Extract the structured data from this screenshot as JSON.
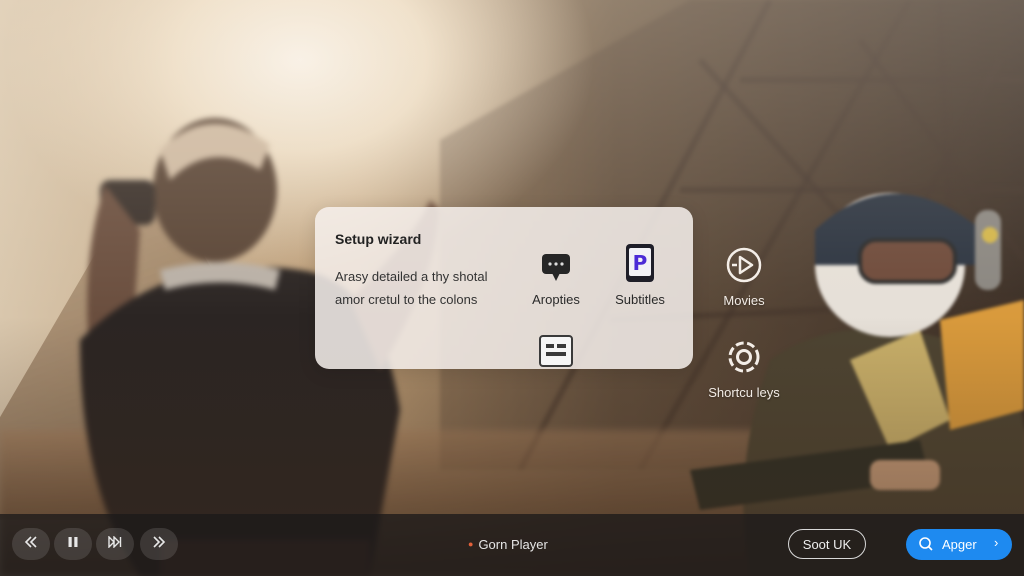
{
  "wizard": {
    "title": "Setup wizard",
    "description_lines": [
      "Arasy detailed a thy shotal",
      "amor cretul to the colons"
    ],
    "options": [
      {
        "label": "Aropties",
        "icon": "speech-bubble-icon"
      },
      {
        "label": "Subtitles",
        "icon": "tablet-p-icon"
      },
      {
        "label": "",
        "icon": "id-card-icon"
      }
    ]
  },
  "side_options": [
    {
      "label": "Movies",
      "icon": "play-circle-icon"
    },
    {
      "label": "Shortcu leys",
      "icon": "gear-ring-icon"
    }
  ],
  "player": {
    "controls": [
      {
        "name": "rewind",
        "icon": "double-chevron-left-icon"
      },
      {
        "name": "pause",
        "icon": "pause-icon"
      },
      {
        "name": "next",
        "icon": "skip-next-icon"
      },
      {
        "name": "fast-forward",
        "icon": "double-chevron-right-icon"
      }
    ],
    "title": "Gorn Player",
    "secondary_button": "Soot UK",
    "primary_button": "Apger",
    "accent_color": "#1e8af0",
    "title_dot_color": "#e2603a"
  }
}
